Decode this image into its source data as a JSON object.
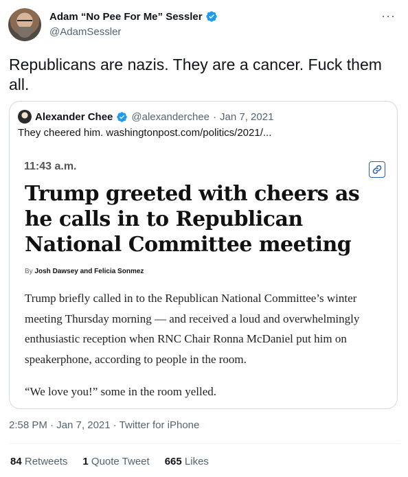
{
  "author": {
    "display_name": "Adam “No Pee For Me” Sessler",
    "handle": "@AdamSessler",
    "verified": true
  },
  "more_icon": "···",
  "tweet": {
    "text": "Republicans are nazis. They are a cancer. Fuck them all."
  },
  "quoted": {
    "display_name": "Alexander Chee",
    "handle": "@alexanderchee",
    "separator": "·",
    "date": "Jan 7, 2021",
    "text": "They cheered him. washingtonpost.com/politics/2021/...",
    "article": {
      "time": "11:43 a.m.",
      "headline": "Trump greeted with cheers as he calls in to Republican National Committee meeting",
      "byline_prefix": "By",
      "byline_authors": "Josh Dawsey and Felicia Sonmez",
      "paragraph1": "Trump briefly called in to the Republican National Committee’s winter meeting Thursday morning — and received a loud and overwhelmingly enthusiastic reception when RNC Chair Ronna McDaniel put him on speakerphone, according to people in the room.",
      "paragraph2": "“We love you!” some in the room yelled."
    }
  },
  "meta": {
    "timestamp": "2:58 PM · Jan 7, 2021 · Twitter for iPhone"
  },
  "stats": {
    "retweets_count": "84",
    "retweets_label": "Retweets",
    "quotes_count": "1",
    "quotes_label": "Quote Tweet",
    "likes_count": "665",
    "likes_label": "Likes"
  },
  "colors": {
    "verified_blue": "#1d9bf0",
    "secondary_text": "#536471",
    "link_icon_blue": "#2a5db0"
  },
  "icons": {
    "verified": "verified-badge-icon",
    "more": "more-options-icon",
    "link": "link-icon"
  }
}
